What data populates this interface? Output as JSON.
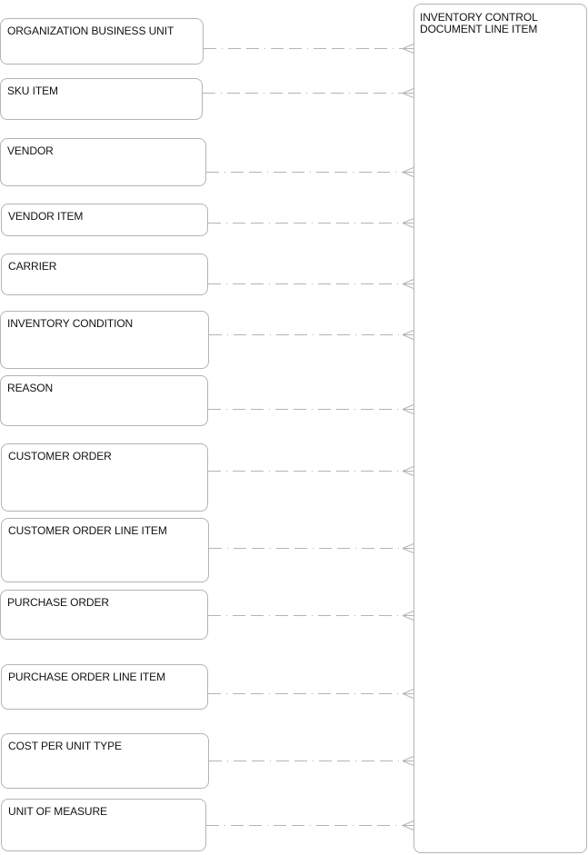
{
  "diagram": {
    "type": "entity-relationship",
    "colors": {
      "border": "#b4b4b4",
      "connector": "#b4b4b4",
      "text": "#111111",
      "background": "#ffffff"
    },
    "main_entity": {
      "name": "INVENTORY CONTROL\nDOCUMENT LINE ITEM"
    },
    "entities": [
      {
        "name": "ORGANIZATION BUSINESS UNIT"
      },
      {
        "name": "SKU ITEM"
      },
      {
        "name": "VENDOR"
      },
      {
        "name": "VENDOR ITEM"
      },
      {
        "name": "CARRIER"
      },
      {
        "name": "INVENTORY CONDITION"
      },
      {
        "name": "REASON"
      },
      {
        "name": "CUSTOMER ORDER"
      },
      {
        "name": "CUSTOMER ORDER LINE ITEM"
      },
      {
        "name": "PURCHASE ORDER"
      },
      {
        "name": "PURCHASE ORDER LINE ITEM"
      },
      {
        "name": "COST PER UNIT TYPE"
      },
      {
        "name": "UNIT OF MEASURE"
      }
    ],
    "relationships": [
      {
        "from": "ORGANIZATION BUSINESS UNIT",
        "to": "INVENTORY CONTROL DOCUMENT LINE ITEM",
        "line_style": "dashed",
        "to_cardinality": "many",
        "from_cardinality": "one"
      },
      {
        "from": "SKU ITEM",
        "to": "INVENTORY CONTROL DOCUMENT LINE ITEM",
        "line_style": "dashed",
        "to_cardinality": "many",
        "from_cardinality": "one"
      },
      {
        "from": "VENDOR",
        "to": "INVENTORY CONTROL DOCUMENT LINE ITEM",
        "line_style": "dashed",
        "to_cardinality": "many",
        "from_cardinality": "one"
      },
      {
        "from": "VENDOR ITEM",
        "to": "INVENTORY CONTROL DOCUMENT LINE ITEM",
        "line_style": "dashed",
        "to_cardinality": "many",
        "from_cardinality": "one"
      },
      {
        "from": "CARRIER",
        "to": "INVENTORY CONTROL DOCUMENT LINE ITEM",
        "line_style": "dashed",
        "to_cardinality": "many",
        "from_cardinality": "one"
      },
      {
        "from": "INVENTORY CONDITION",
        "to": "INVENTORY CONTROL DOCUMENT LINE ITEM",
        "line_style": "dashed",
        "to_cardinality": "many",
        "from_cardinality": "one"
      },
      {
        "from": "REASON",
        "to": "INVENTORY CONTROL DOCUMENT LINE ITEM",
        "line_style": "dashed",
        "to_cardinality": "many",
        "from_cardinality": "one"
      },
      {
        "from": "CUSTOMER ORDER",
        "to": "INVENTORY CONTROL DOCUMENT LINE ITEM",
        "line_style": "dashed",
        "to_cardinality": "many",
        "from_cardinality": "one"
      },
      {
        "from": "CUSTOMER ORDER LINE ITEM",
        "to": "INVENTORY CONTROL DOCUMENT LINE ITEM",
        "line_style": "dashed",
        "to_cardinality": "many",
        "from_cardinality": "one"
      },
      {
        "from": "PURCHASE ORDER",
        "to": "INVENTORY CONTROL DOCUMENT LINE ITEM",
        "line_style": "dashed",
        "to_cardinality": "many",
        "from_cardinality": "one"
      },
      {
        "from": "PURCHASE ORDER LINE ITEM",
        "to": "INVENTORY CONTROL DOCUMENT LINE ITEM",
        "line_style": "dashed",
        "to_cardinality": "many",
        "from_cardinality": "one"
      },
      {
        "from": "COST PER UNIT TYPE",
        "to": "INVENTORY CONTROL DOCUMENT LINE ITEM",
        "line_style": "dashed",
        "to_cardinality": "many",
        "from_cardinality": "one"
      },
      {
        "from": "UNIT OF MEASURE",
        "to": "INVENTORY CONTROL DOCUMENT LINE ITEM",
        "line_style": "dashed",
        "to_cardinality": "many",
        "from_cardinality": "one"
      }
    ]
  }
}
